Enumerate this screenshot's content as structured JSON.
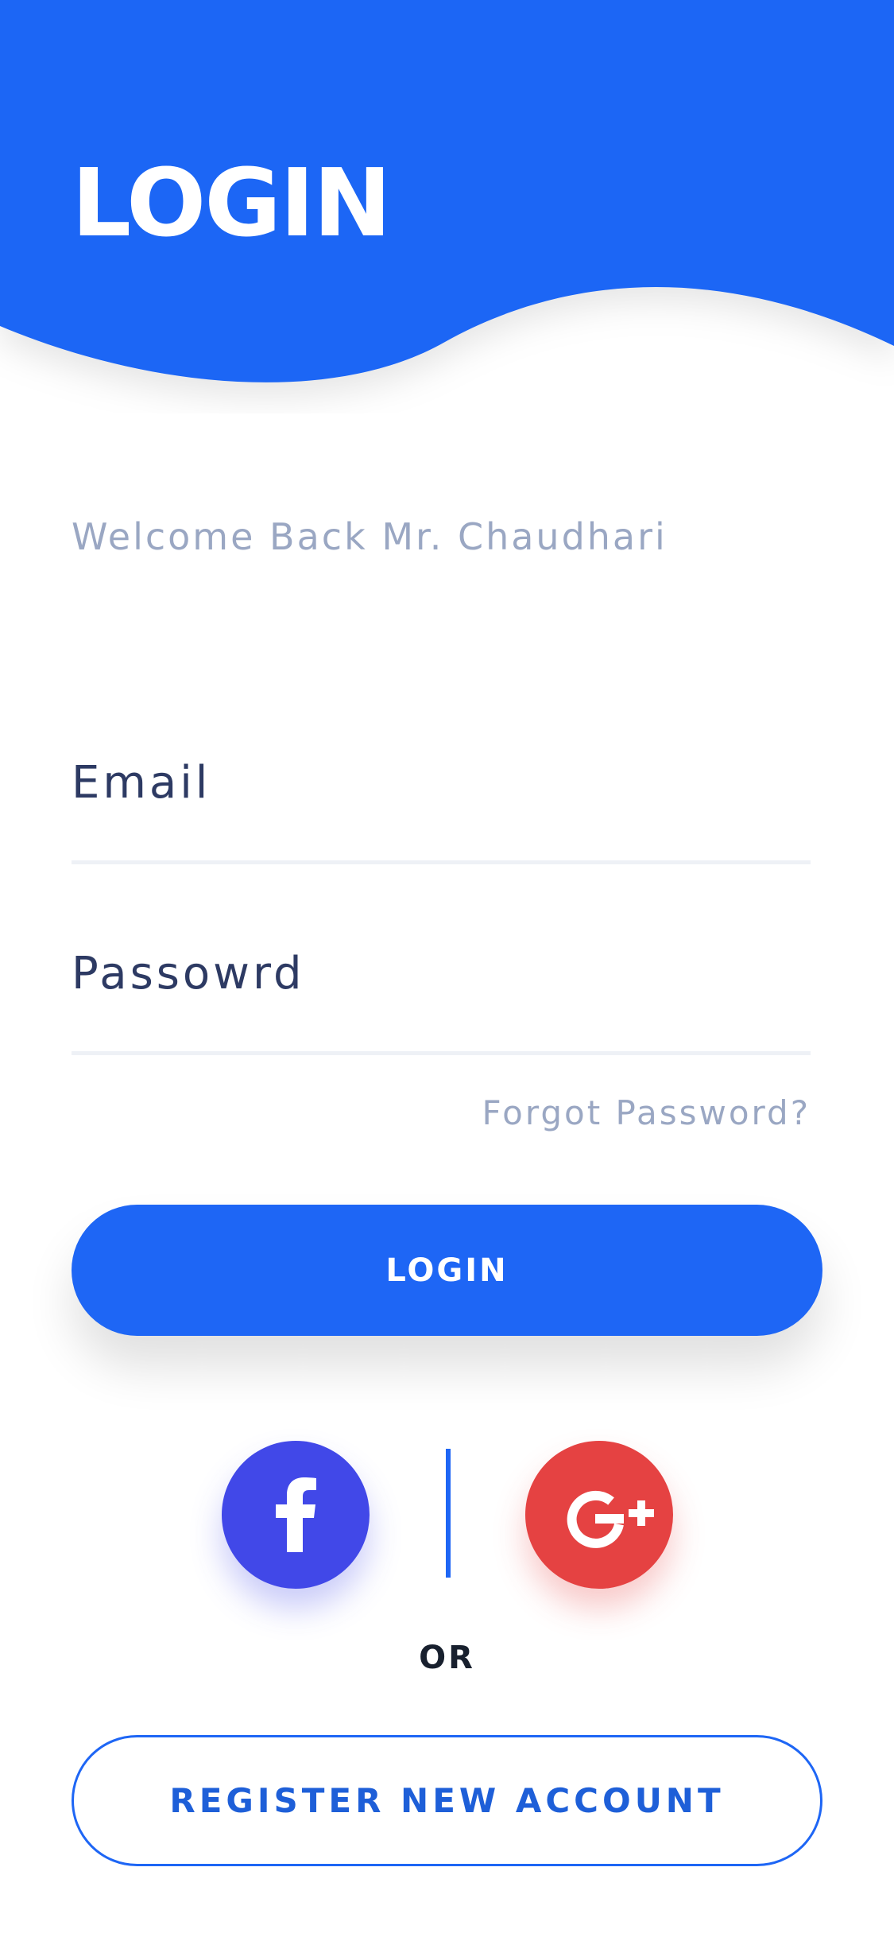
{
  "header": {
    "title": "LOGIN",
    "background_color": "#1E66F5"
  },
  "welcome_text": "Welcome Back Mr. Chaudhari",
  "form": {
    "email_label": "Email",
    "email_value": "",
    "password_label": "Passowrd",
    "password_value": ""
  },
  "forgot_password_label": "Forgot Password?",
  "login_button_label": "LOGIN",
  "social": {
    "facebook_icon": "facebook-icon",
    "facebook_color": "#4148E8",
    "google_icon": "google-plus-icon",
    "google_color": "#E54242"
  },
  "or_label": "OR",
  "register_button_label": "REGISTER NEW ACCOUNT",
  "colors": {
    "accent": "#1E66F5",
    "muted_text": "#9AA7C3",
    "label_text": "#2D3A63"
  }
}
